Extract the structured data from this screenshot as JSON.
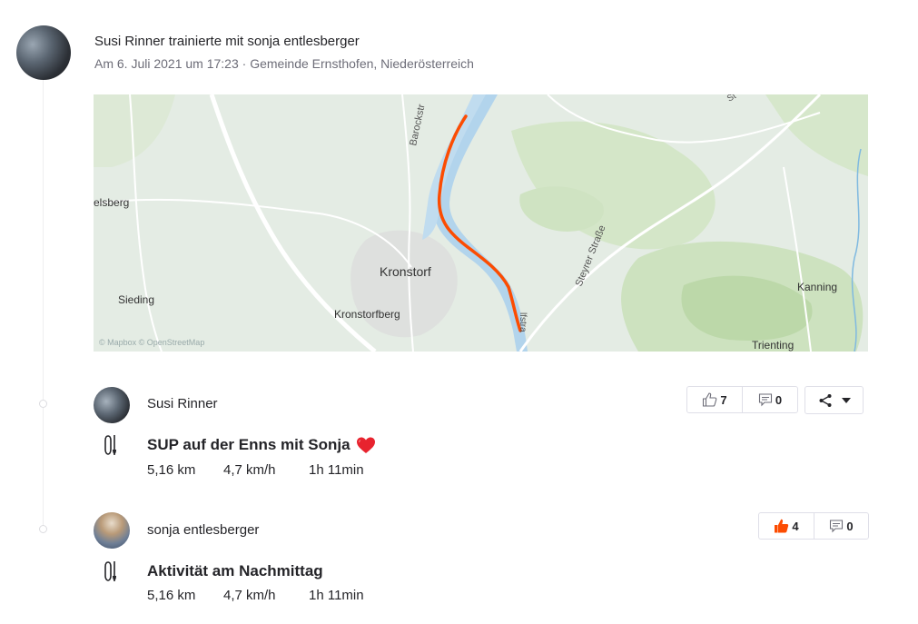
{
  "group": {
    "title": "Susi Rinner trainierte mit sonja entlesberger",
    "meta": "Am 6. Juli 2021 um 17:23 · Gemeinde Ernsthofen, Niederösterreich"
  },
  "map": {
    "labels": {
      "kronstorf": "Kronstorf",
      "kronstorfberg": "Kronstorfberg",
      "sieding": "Sieding",
      "elsberg": "elsberg",
      "kanning": "Kanning",
      "trienting": "Trienting",
      "steyrer_strasse": "Steyrer Straße",
      "barockstr": "Barockstr",
      "lfstra": "lfstra",
      "top_right": "St",
      "attribution": "© Mapbox © OpenStreetMap"
    },
    "route_color": "#fc4c02"
  },
  "activities": [
    {
      "athlete": "Susi Rinner",
      "title": "SUP auf der Enns mit Sonja",
      "emoji": "❤️",
      "distance": "5,16 km",
      "speed": "4,7 km/h",
      "time": "1h 11min",
      "kudos": "7",
      "comments": "0",
      "kudos_given": false
    },
    {
      "athlete": "sonja entlesberger",
      "title": "Aktivität am Nachmittag",
      "distance": "5,16 km",
      "speed": "4,7 km/h",
      "time": "1h 11min",
      "kudos": "4",
      "comments": "0",
      "kudos_given": true
    }
  ],
  "icons": {
    "kudos": "thumbs-up-icon",
    "comment": "comment-icon",
    "share": "share-icon",
    "sport": "stand-up-paddle-icon",
    "dropdown": "caret-down-icon"
  },
  "colors": {
    "accent": "#fc4c02",
    "text": "#242428",
    "muted": "#6d6d78"
  }
}
